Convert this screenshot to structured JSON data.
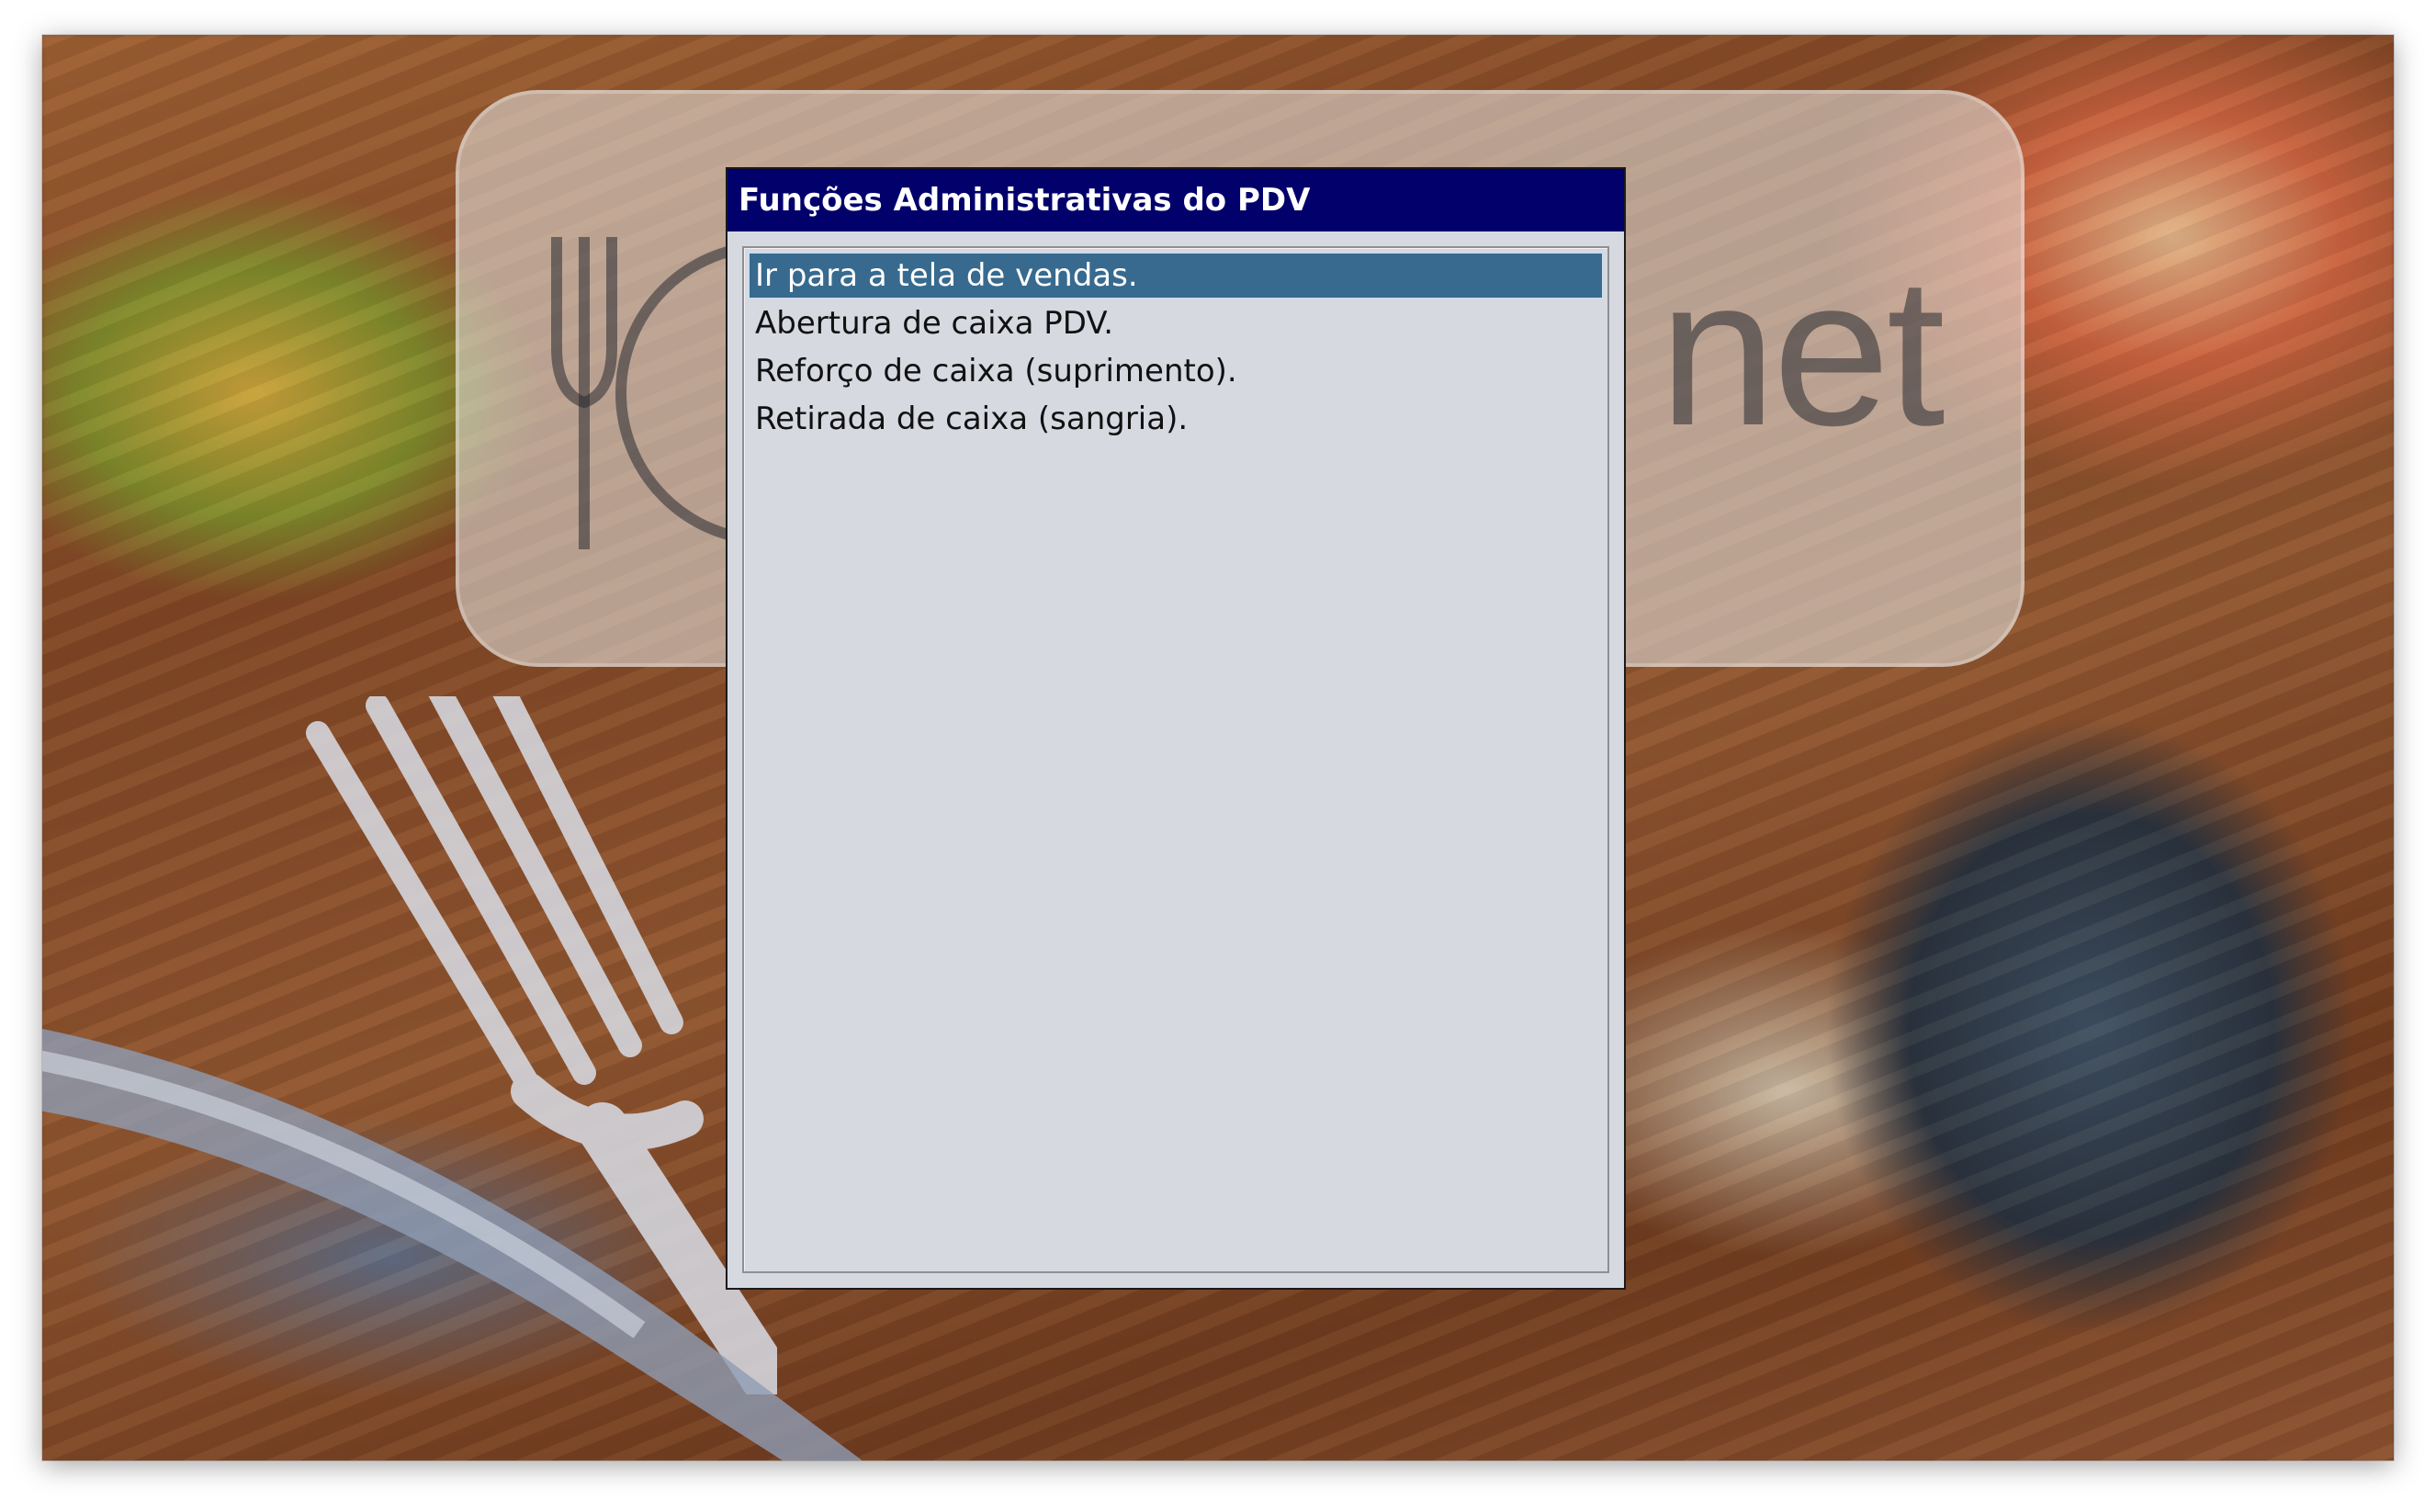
{
  "window": {
    "title": "Funções Administrativas do PDV"
  },
  "background": {
    "logo_text": "net",
    "logo_icon": "plate-fork-knife-icon"
  },
  "menu": {
    "selected_index": 0,
    "items": [
      {
        "label": "Ir para a tela de vendas."
      },
      {
        "label": "Abertura de caixa PDV."
      },
      {
        "label": "Reforço de caixa (suprimento)."
      },
      {
        "label": "Retirada de caixa (sangria)."
      }
    ]
  },
  "colors": {
    "title_bar": "#02006b",
    "title_text": "#ffffff",
    "dialog_bg": "#d7d9e1",
    "selection_bg": "#376a8e",
    "selection_text": "#ffffff",
    "item_text": "#111111"
  }
}
